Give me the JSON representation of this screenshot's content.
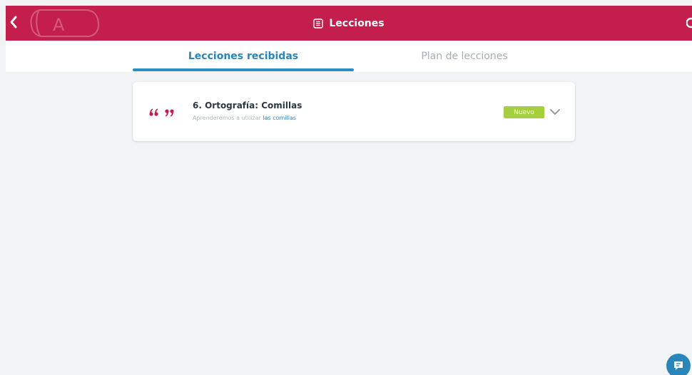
{
  "header": {
    "title": "Lecciones",
    "logo_letter": "A"
  },
  "tabs": [
    {
      "label": "Lecciones recibidas",
      "active": true
    },
    {
      "label": "Plan de lecciones",
      "active": false
    }
  ],
  "lessons": [
    {
      "title": "6. Ortografía: Comillas",
      "subtitle_prefix": "Aprenderemos a utilizar",
      "subtitle_keyword": "las comillas",
      "badge": "Nuevo",
      "icon": "quotation-marks-icon"
    }
  ],
  "icons": {
    "back": "back-arrow-icon",
    "title": "list-document-icon",
    "expand": "chevron-down-icon",
    "chat": "chat-bubble-icon"
  },
  "colors": {
    "header": "#c41e4c",
    "accent": "#2a86ba",
    "badge": "#a6cf3f",
    "background": "#f2f3f5"
  }
}
